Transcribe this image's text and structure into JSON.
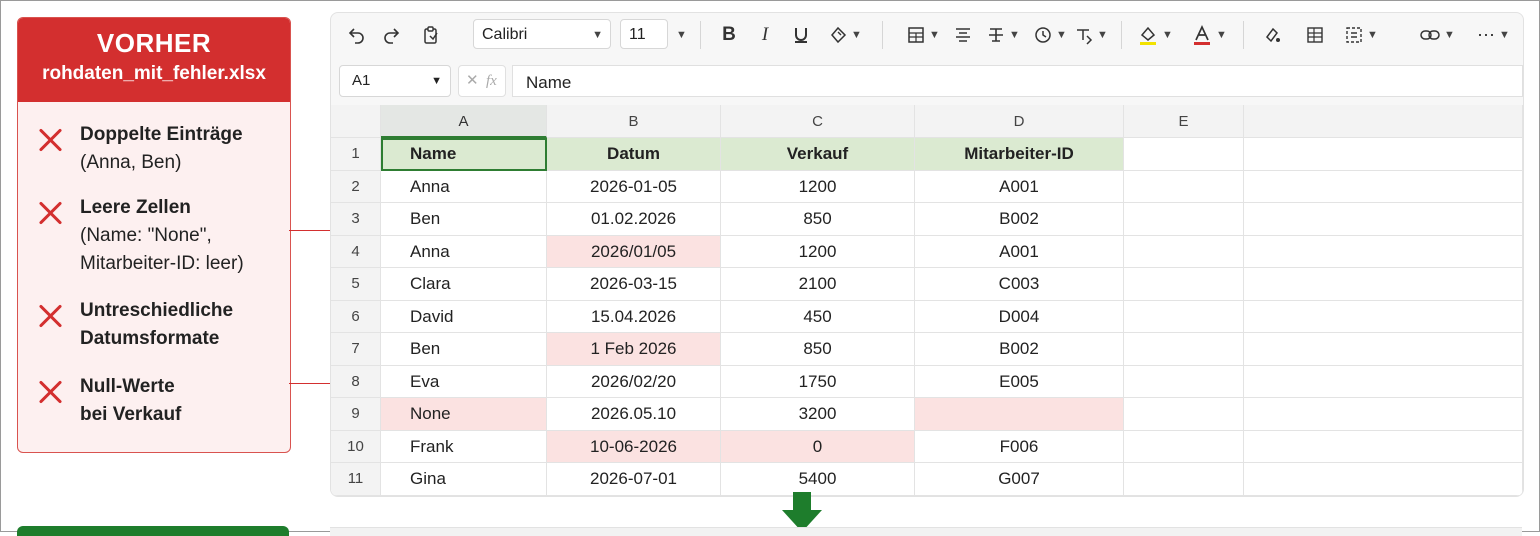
{
  "panel": {
    "title": "VORHER",
    "filename": "rohdaten_mit_fehler.xlsx",
    "issues": [
      {
        "bold": [
          "Doppelte Einträge"
        ],
        "normal": [
          "(Anna, Ben)"
        ]
      },
      {
        "bold": [
          "Leere Zellen"
        ],
        "normal": [
          "(Name: \"None\",",
          "Mitarbeiter-ID: leer)"
        ]
      },
      {
        "bold": [
          "Untreschiedliche",
          "Datumsformate"
        ],
        "normal": []
      },
      {
        "bold": [
          "Null-Werte",
          "bei Verkauf"
        ],
        "normal": []
      }
    ]
  },
  "toolbar": {
    "font_name": "Calibri",
    "font_size": "11"
  },
  "formula_bar": {
    "cell_ref": "A1",
    "value": "Name"
  },
  "sheet": {
    "columns": [
      "A",
      "B",
      "C",
      "D",
      "E"
    ],
    "rows": [
      {
        "num": "1",
        "cells": [
          "Name",
          "Datum",
          "Verkauf",
          "Mitarbeiter-ID",
          ""
        ]
      },
      {
        "num": "2",
        "cells": [
          "Anna",
          "2026-01-05",
          "1200",
          "A001",
          ""
        ]
      },
      {
        "num": "3",
        "cells": [
          "Ben",
          "01.02.2026",
          "850",
          "B002",
          ""
        ]
      },
      {
        "num": "4",
        "cells": [
          "Anna",
          "2026/01/05",
          "1200",
          "A001",
          ""
        ]
      },
      {
        "num": "5",
        "cells": [
          "Clara",
          "2026-03-15",
          "2100",
          "C003",
          ""
        ]
      },
      {
        "num": "6",
        "cells": [
          "David",
          "15.04.2026",
          "450",
          "D004",
          ""
        ]
      },
      {
        "num": "7",
        "cells": [
          "Ben",
          "1 Feb 2026",
          "850",
          "B002",
          ""
        ]
      },
      {
        "num": "8",
        "cells": [
          "Eva",
          "2026/02/20",
          "1750",
          "E005",
          ""
        ]
      },
      {
        "num": "9",
        "cells": [
          "None",
          "2026.05.10",
          "3200",
          "",
          ""
        ]
      },
      {
        "num": "10",
        "cells": [
          "Frank",
          "10-06-2026",
          "0",
          "F006",
          ""
        ]
      },
      {
        "num": "11",
        "cells": [
          "Gina",
          "2026-07-01",
          "5400",
          "G007",
          ""
        ]
      }
    ],
    "highlighted": [
      [
        3,
        1
      ],
      [
        6,
        1
      ],
      [
        8,
        0
      ],
      [
        8,
        3
      ],
      [
        9,
        1
      ],
      [
        9,
        2
      ]
    ]
  },
  "colors": {
    "error_red": "#d32f2f",
    "panel_bg": "#fdf0f0",
    "header_green": "#dbead1",
    "highlight_pink": "#fbe2e1",
    "arrow_green": "#1e7d2c"
  }
}
